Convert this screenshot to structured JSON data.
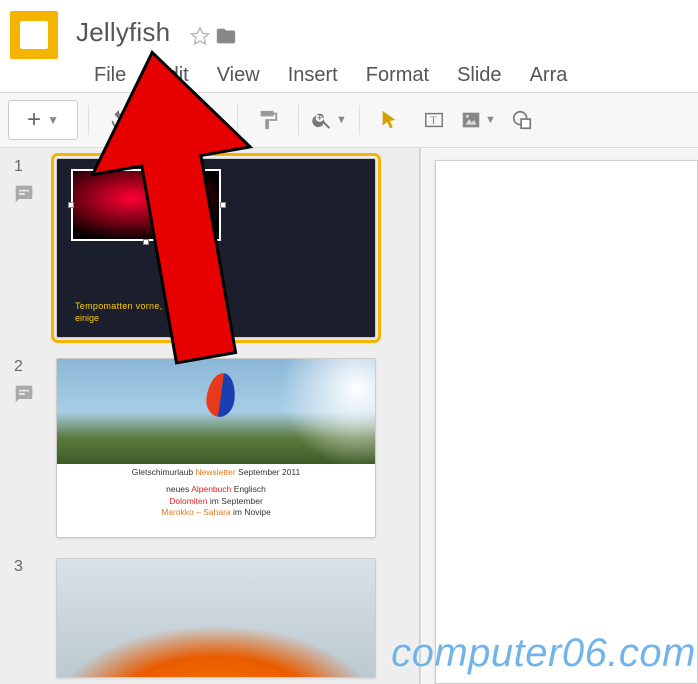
{
  "header": {
    "doc_title": "Jellyfish"
  },
  "menu": {
    "items": [
      "File",
      "Edit",
      "View",
      "Insert",
      "Format",
      "Slide",
      "Arra"
    ]
  },
  "toolbar": {
    "new_plus": "+",
    "icons": {
      "undo": "undo-icon",
      "redo": "redo-icon",
      "print": "print-icon",
      "paint": "paint-format-icon",
      "zoom": "zoom-icon",
      "select": "select-icon",
      "textbox": "textbox-icon",
      "image": "image-icon",
      "shape": "shape-icon"
    }
  },
  "slides": [
    {
      "num": "1",
      "selected": true,
      "text1": "Tempomatten vorne,",
      "text2": "einige"
    },
    {
      "num": "2",
      "selected": false,
      "line1_a": "Gletschimurlaub ",
      "line1_b": "Newsletter",
      "line1_c": " September 2011",
      "line2_a": "neues ",
      "line2_b": "Alpenbuch",
      "line2_c": " Englisch",
      "line3_a": "Dolomiten",
      "line3_b": " im September",
      "line4_a": "Marokko – Sahara",
      "line4_b": " im Novipe"
    },
    {
      "num": "3",
      "selected": false
    }
  ],
  "watermark": "computer06.com"
}
